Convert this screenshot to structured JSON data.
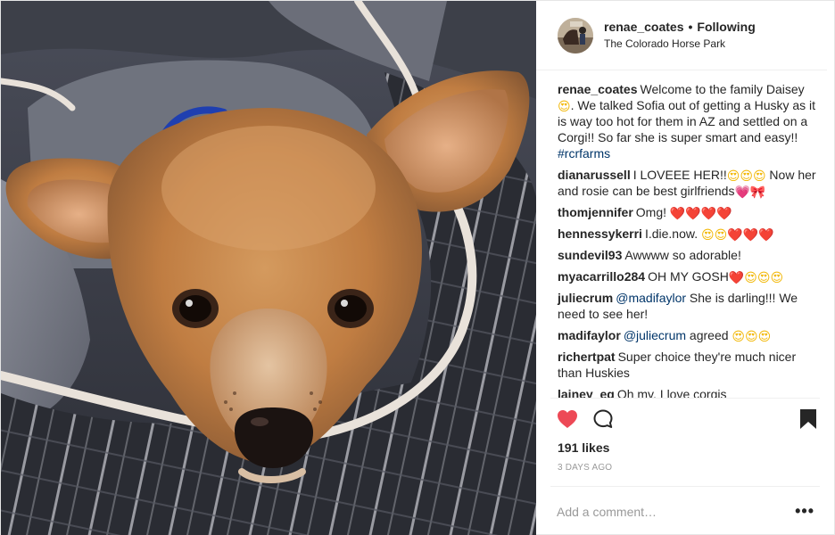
{
  "post": {
    "author": {
      "username": "renae_coates",
      "separator": "•",
      "follow_status": "Following",
      "location": "The Colorado Horse Park"
    },
    "comments": [
      {
        "user": "renae_coates",
        "parts": [
          {
            "t": "text",
            "v": "Welcome to the family Daisey "
          },
          {
            "t": "emoji",
            "v": "😍",
            "kind": "smile"
          },
          {
            "t": "text",
            "v": ". We talked Sofia out of getting a Husky as it is way too hot for them in AZ and settled on a Corgi!! So far she is super smart and easy!! "
          },
          {
            "t": "tag",
            "v": "#rcrfarms"
          }
        ]
      },
      {
        "user": "dianarussell",
        "parts": [
          {
            "t": "text",
            "v": "I LOVEEE HER!!"
          },
          {
            "t": "emoji",
            "v": "😍😍😍",
            "kind": "smile"
          },
          {
            "t": "text",
            "v": " Now her and rosie can be best girlfriends"
          },
          {
            "t": "emoji",
            "v": "💗🎀",
            "kind": "pink"
          }
        ]
      },
      {
        "user": "thomjennifer",
        "parts": [
          {
            "t": "text",
            "v": "Omg! "
          },
          {
            "t": "emoji",
            "v": "❤️❤️❤️❤️",
            "kind": "heart"
          }
        ]
      },
      {
        "user": "hennessykerri",
        "parts": [
          {
            "t": "text",
            "v": "I.die.now. "
          },
          {
            "t": "emoji",
            "v": "😍😍",
            "kind": "smile"
          },
          {
            "t": "emoji",
            "v": "❤️❤️❤️",
            "kind": "heart"
          }
        ]
      },
      {
        "user": "sundevil93",
        "parts": [
          {
            "t": "text",
            "v": "Awwww so adorable!"
          }
        ]
      },
      {
        "user": "myacarrillo284",
        "parts": [
          {
            "t": "text",
            "v": "OH MY GOSH"
          },
          {
            "t": "emoji",
            "v": "❤️",
            "kind": "heart"
          },
          {
            "t": "emoji",
            "v": "😍😍😍",
            "kind": "smile"
          }
        ]
      },
      {
        "user": "juliecrum",
        "parts": [
          {
            "t": "mention",
            "v": "@madifaylor"
          },
          {
            "t": "text",
            "v": " She is darling!!! We need to see her!"
          }
        ]
      },
      {
        "user": "madifaylor",
        "parts": [
          {
            "t": "mention",
            "v": "@juliecrum"
          },
          {
            "t": "text",
            "v": " agreed "
          },
          {
            "t": "emoji",
            "v": "😍😍😍",
            "kind": "smile"
          }
        ]
      },
      {
        "user": "richertpat",
        "parts": [
          {
            "t": "text",
            "v": "Super choice they're much nicer than Huskies"
          }
        ]
      },
      {
        "user": "lainey_eq",
        "parts": [
          {
            "t": "text",
            "v": "Oh my, I love corgis"
          }
        ]
      }
    ],
    "actions": {
      "like_icon": "heart-filled-icon",
      "comment_icon": "speech-bubble-icon",
      "save_icon": "bookmark-filled-icon",
      "like_color": "#ed4956"
    },
    "likes": "191 likes",
    "timestamp": "3 DAYS AGO",
    "add_comment": {
      "placeholder": "Add a comment…",
      "more_label": "•••"
    }
  }
}
